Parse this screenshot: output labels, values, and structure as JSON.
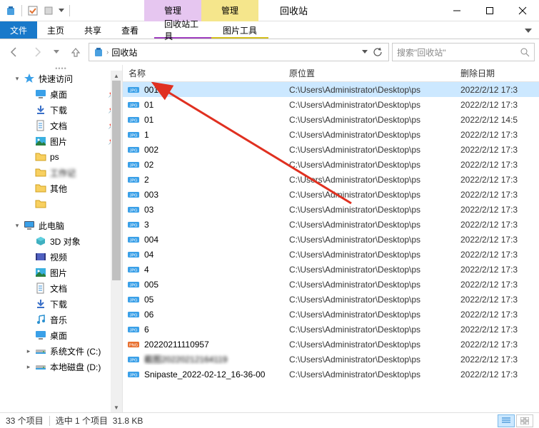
{
  "title": "回收站",
  "context_tabs": [
    "管理",
    "管理"
  ],
  "ribbon_tabs": [
    "文件",
    "主页",
    "共享",
    "查看",
    "回收站工具",
    "图片工具"
  ],
  "address": {
    "path": "回收站",
    "search_placeholder": "搜索\"回收站\""
  },
  "columns": {
    "name": "名称",
    "location": "原位置",
    "deleted": "删除日期"
  },
  "sidebar": {
    "quick_access": "快速访问",
    "items_qa": [
      {
        "label": "桌面",
        "icon": "desktop",
        "pinned": true
      },
      {
        "label": "下载",
        "icon": "download",
        "pinned": true
      },
      {
        "label": "文档",
        "icon": "document",
        "pinned": true
      },
      {
        "label": "图片",
        "icon": "picture",
        "pinned": true
      },
      {
        "label": "ps",
        "icon": "folder",
        "pinned": false
      },
      {
        "label": "工作记",
        "icon": "folder",
        "pinned": false,
        "blur": true
      },
      {
        "label": "其他",
        "icon": "folder",
        "pinned": false
      },
      {
        "label": "",
        "icon": "folder",
        "pinned": false,
        "blur": true
      }
    ],
    "this_pc": "此电脑",
    "items_pc": [
      {
        "label": "3D 对象",
        "icon": "3d"
      },
      {
        "label": "视频",
        "icon": "video"
      },
      {
        "label": "图片",
        "icon": "picture"
      },
      {
        "label": "文档",
        "icon": "document"
      },
      {
        "label": "下载",
        "icon": "download"
      },
      {
        "label": "音乐",
        "icon": "music"
      },
      {
        "label": "桌面",
        "icon": "desktop"
      },
      {
        "label": "系统文件 (C:)",
        "icon": "drive"
      },
      {
        "label": "本地磁盘 (D:)",
        "icon": "drive"
      }
    ]
  },
  "files": [
    {
      "name": "001",
      "type": "jpg",
      "loc": "C:\\Users\\Administrator\\Desktop\\ps",
      "date": "2022/2/12 17:3",
      "selected": true
    },
    {
      "name": "01",
      "type": "jpg",
      "loc": "C:\\Users\\Administrator\\Desktop\\ps",
      "date": "2022/2/12 17:3"
    },
    {
      "name": "01",
      "type": "jpg",
      "loc": "C:\\Users\\Administrator\\Desktop\\ps",
      "date": "2022/2/12 14:5"
    },
    {
      "name": "1",
      "type": "jpg",
      "loc": "C:\\Users\\Administrator\\Desktop\\ps",
      "date": "2022/2/12 17:3"
    },
    {
      "name": "002",
      "type": "jpg",
      "loc": "C:\\Users\\Administrator\\Desktop\\ps",
      "date": "2022/2/12 17:3"
    },
    {
      "name": "02",
      "type": "jpg",
      "loc": "C:\\Users\\Administrator\\Desktop\\ps",
      "date": "2022/2/12 17:3"
    },
    {
      "name": "2",
      "type": "jpg",
      "loc": "C:\\Users\\Administrator\\Desktop\\ps",
      "date": "2022/2/12 17:3"
    },
    {
      "name": "003",
      "type": "jpg",
      "loc": "C:\\Users\\Administrator\\Desktop\\ps",
      "date": "2022/2/12 17:3"
    },
    {
      "name": "03",
      "type": "jpg",
      "loc": "C:\\Users\\Administrator\\Desktop\\ps",
      "date": "2022/2/12 17:3"
    },
    {
      "name": "3",
      "type": "jpg",
      "loc": "C:\\Users\\Administrator\\Desktop\\ps",
      "date": "2022/2/12 17:3"
    },
    {
      "name": "004",
      "type": "jpg",
      "loc": "C:\\Users\\Administrator\\Desktop\\ps",
      "date": "2022/2/12 17:3"
    },
    {
      "name": "04",
      "type": "jpg",
      "loc": "C:\\Users\\Administrator\\Desktop\\ps",
      "date": "2022/2/12 17:3"
    },
    {
      "name": "4",
      "type": "jpg",
      "loc": "C:\\Users\\Administrator\\Desktop\\ps",
      "date": "2022/2/12 17:3"
    },
    {
      "name": "005",
      "type": "jpg",
      "loc": "C:\\Users\\Administrator\\Desktop\\ps",
      "date": "2022/2/12 17:3"
    },
    {
      "name": "05",
      "type": "jpg",
      "loc": "C:\\Users\\Administrator\\Desktop\\ps",
      "date": "2022/2/12 17:3"
    },
    {
      "name": "06",
      "type": "jpg",
      "loc": "C:\\Users\\Administrator\\Desktop\\ps",
      "date": "2022/2/12 17:3"
    },
    {
      "name": "6",
      "type": "jpg",
      "loc": "C:\\Users\\Administrator\\Desktop\\ps",
      "date": "2022/2/12 17:3"
    },
    {
      "name": "20220211110957",
      "type": "png",
      "loc": "C:\\Users\\Administrator\\Desktop\\ps",
      "date": "2022/2/12 17:3"
    },
    {
      "name": "截图20220212164119",
      "type": "jpg",
      "loc": "C:\\Users\\Administrator\\Desktop\\ps",
      "date": "2022/2/12 17:3",
      "blur": true
    },
    {
      "name": "Snipaste_2022-02-12_16-36-00",
      "type": "jpg",
      "loc": "C:\\Users\\Administrator\\Desktop\\ps",
      "date": "2022/2/12 17:3"
    }
  ],
  "statusbar": {
    "count": "33 个项目",
    "selected": "选中 1 个项目",
    "size": "31.8 KB"
  }
}
